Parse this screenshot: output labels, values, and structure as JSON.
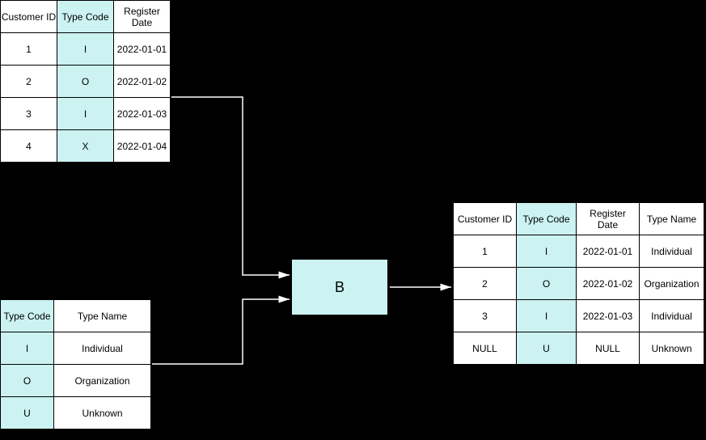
{
  "table1": {
    "headers": [
      "Customer ID",
      "Type Code",
      "Register\nDate"
    ],
    "rows": [
      [
        "1",
        "I",
        "2022-01-01"
      ],
      [
        "2",
        "O",
        "2022-01-02"
      ],
      [
        "3",
        "I",
        "2022-01-03"
      ],
      [
        "4",
        "X",
        "2022-01-04"
      ]
    ]
  },
  "table2": {
    "headers": [
      "Type Code",
      "Type Name"
    ],
    "rows": [
      [
        "I",
        "Individual"
      ],
      [
        "O",
        "Organization"
      ],
      [
        "U",
        "Unknown"
      ]
    ]
  },
  "join_label": "B",
  "table3": {
    "headers": [
      "Customer ID",
      "Type Code",
      "Register\nDate",
      "Type Name"
    ],
    "rows": [
      [
        "1",
        "I",
        "2022-01-01",
        "Individual"
      ],
      [
        "2",
        "O",
        "2022-01-02",
        "Organization"
      ],
      [
        "3",
        "I",
        "2022-01-03",
        "Individual"
      ],
      [
        "NULL",
        "U",
        "NULL",
        "Unknown"
      ]
    ]
  }
}
